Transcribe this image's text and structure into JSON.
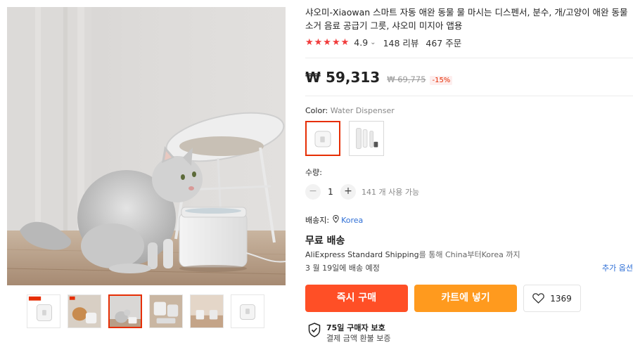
{
  "product": {
    "title_line1": "샤오미-Xiaowan 스마트 자동 애완 동물 물 마시는 디스펜서, 분수, 개/고양이 애완 동물",
    "title_line2": "소거 음료 공급기 그릇, 샤오미 미지아 앱용",
    "stars": "★★★★★",
    "rating": "4.9",
    "rating_chevron": "⌄",
    "reviews": "148 리뷰",
    "orders": "467 주문",
    "rating_score": 4.9
  },
  "price": {
    "current": "₩ 59,313",
    "original": "₩ 69,775",
    "discount": "-15%"
  },
  "color": {
    "label": "Color:",
    "selected_value": "Water Dispenser"
  },
  "quantity": {
    "label": "수량:",
    "minus": "−",
    "value": "1",
    "plus": "+",
    "available": "141 개 사용 가능"
  },
  "shipping": {
    "to_label": "배송지:",
    "country": "Korea",
    "free_label": "무료 배송",
    "method_prefix": "AliExpress Standard Shipping",
    "method_rest": "를 통해 China부터Korea 까지",
    "delivery_date": "3 월 19일에 배송 예정",
    "more_options": "추가 옵션"
  },
  "actions": {
    "buy_now": "즉시 구매",
    "add_to_cart": "카트에 넣기",
    "wishlist_count": "1369"
  },
  "protection": {
    "title": "75일 구매자 보호",
    "subtitle": "결제 금액 환불 보증"
  },
  "colors": {
    "accent_red": "#e62e04",
    "buy_button": "#ff4f26",
    "cart_button": "#ff9a1e",
    "link_blue": "#2f6fd6",
    "star": "#f13c3c"
  },
  "icons": {
    "location": "location-pin-icon",
    "heart": "heart-icon",
    "shield": "shield-check-icon"
  }
}
